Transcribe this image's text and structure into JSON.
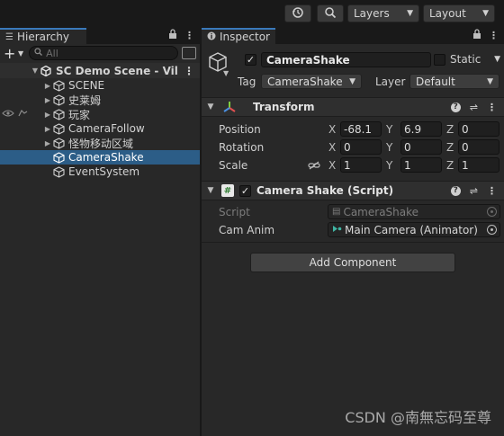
{
  "toolbar": {
    "history_icon": "history-icon",
    "search_icon": "search-icon",
    "layers_label": "Layers",
    "layout_label": "Layout"
  },
  "hierarchy": {
    "tab_label": "Hierarchy",
    "search_placeholder": "All",
    "scene_name": "SC Demo Scene - Vil",
    "items": [
      {
        "label": "SCENE",
        "expandable": true
      },
      {
        "label": "史莱姆",
        "expandable": true
      },
      {
        "label": "玩家",
        "expandable": true
      },
      {
        "label": "CameraFollow",
        "expandable": true
      },
      {
        "label": "怪物移动区域",
        "expandable": true
      },
      {
        "label": "CameraShake",
        "expandable": false,
        "selected": true
      },
      {
        "label": "EventSystem",
        "expandable": false
      }
    ]
  },
  "inspector": {
    "tab_label": "Inspector",
    "object_name": "CameraShake",
    "static_label": "Static",
    "tag_label": "Tag",
    "tag_value": "CameraShake",
    "layer_label": "Layer",
    "layer_value": "Default",
    "transform": {
      "title": "Transform",
      "position_label": "Position",
      "rotation_label": "Rotation",
      "scale_label": "Scale",
      "axes": [
        "X",
        "Y",
        "Z"
      ],
      "position": [
        "-68.1",
        "6.9",
        "0"
      ],
      "rotation": [
        "0",
        "0",
        "0"
      ],
      "scale": [
        "1",
        "1",
        "1"
      ]
    },
    "script_component": {
      "title": "Camera Shake (Script)",
      "script_label": "Script",
      "script_value": "CameraShake",
      "cam_anim_label": "Cam Anim",
      "cam_anim_value": "Main Camera (Animator)"
    },
    "add_component_label": "Add Component"
  },
  "watermark": "CSDN @南無忘码至尊",
  "colors": {
    "selection": "#2c5d87",
    "tab_accent": "#3a79bb",
    "panel_bg": "#282828"
  }
}
